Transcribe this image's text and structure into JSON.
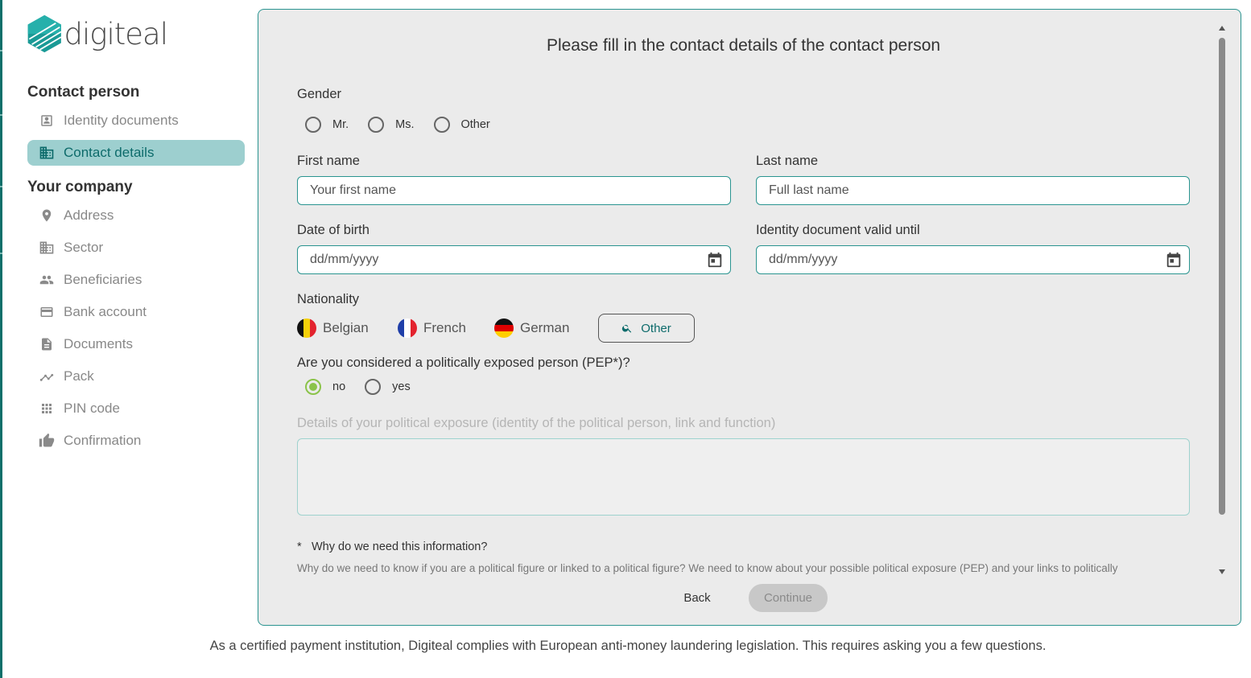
{
  "brand": {
    "name": "digiteal",
    "accent": "#0e6f6a",
    "highlight": "#9dcfcf"
  },
  "sidebar": {
    "sections": [
      {
        "title": "Contact person"
      },
      {
        "title": "Your company"
      }
    ],
    "items": [
      {
        "label": "Identity documents",
        "icon": "id-card-icon",
        "active": false
      },
      {
        "label": "Contact details",
        "icon": "building-icon",
        "active": true
      },
      {
        "label": "Address",
        "icon": "location-pin-icon",
        "active": false
      },
      {
        "label": "Sector",
        "icon": "building-icon",
        "active": false
      },
      {
        "label": "Beneficiaries",
        "icon": "people-icon",
        "active": false
      },
      {
        "label": "Bank account",
        "icon": "credit-card-icon",
        "active": false
      },
      {
        "label": "Documents",
        "icon": "document-icon",
        "active": false
      },
      {
        "label": "Pack",
        "icon": "trend-icon",
        "active": false
      },
      {
        "label": "PIN code",
        "icon": "keypad-icon",
        "active": false
      },
      {
        "label": "Confirmation",
        "icon": "thumbs-up-icon",
        "active": false
      }
    ]
  },
  "form": {
    "title": "Please fill in the contact details of the contact person",
    "gender": {
      "label": "Gender",
      "options": [
        "Mr.",
        "Ms.",
        "Other"
      ],
      "selected": null
    },
    "first_name": {
      "label": "First name",
      "placeholder": "Your first name",
      "value": ""
    },
    "last_name": {
      "label": "Last name",
      "placeholder": "Full last name",
      "value": ""
    },
    "date_of_birth": {
      "label": "Date of birth",
      "placeholder": "dd/mm/yyyy"
    },
    "id_valid_until": {
      "label": "Identity document valid until",
      "placeholder": "dd/mm/yyyy"
    },
    "nationality": {
      "label": "Nationality",
      "options": [
        "Belgian",
        "French",
        "German"
      ],
      "other_label": "Other"
    },
    "pep": {
      "question": "Are you considered a politically exposed person (PEP*)?",
      "options": [
        "no",
        "yes"
      ],
      "selected": "no"
    },
    "pep_details": {
      "label": "Details of your political exposure (identity of the political person, link and function)",
      "value": ""
    },
    "why": {
      "star": "*",
      "title": "Why do we need this information?",
      "text": "Why do we need to know if you are a political figure or linked to a political figure? We need to know about your possible political exposure (PEP) and your links to politically"
    },
    "buttons": {
      "back": "Back",
      "continue": "Continue"
    }
  },
  "footer": {
    "text": "As a certified payment institution, Digiteal complies with European anti-money laundering legislation. This requires asking you a few questions."
  }
}
